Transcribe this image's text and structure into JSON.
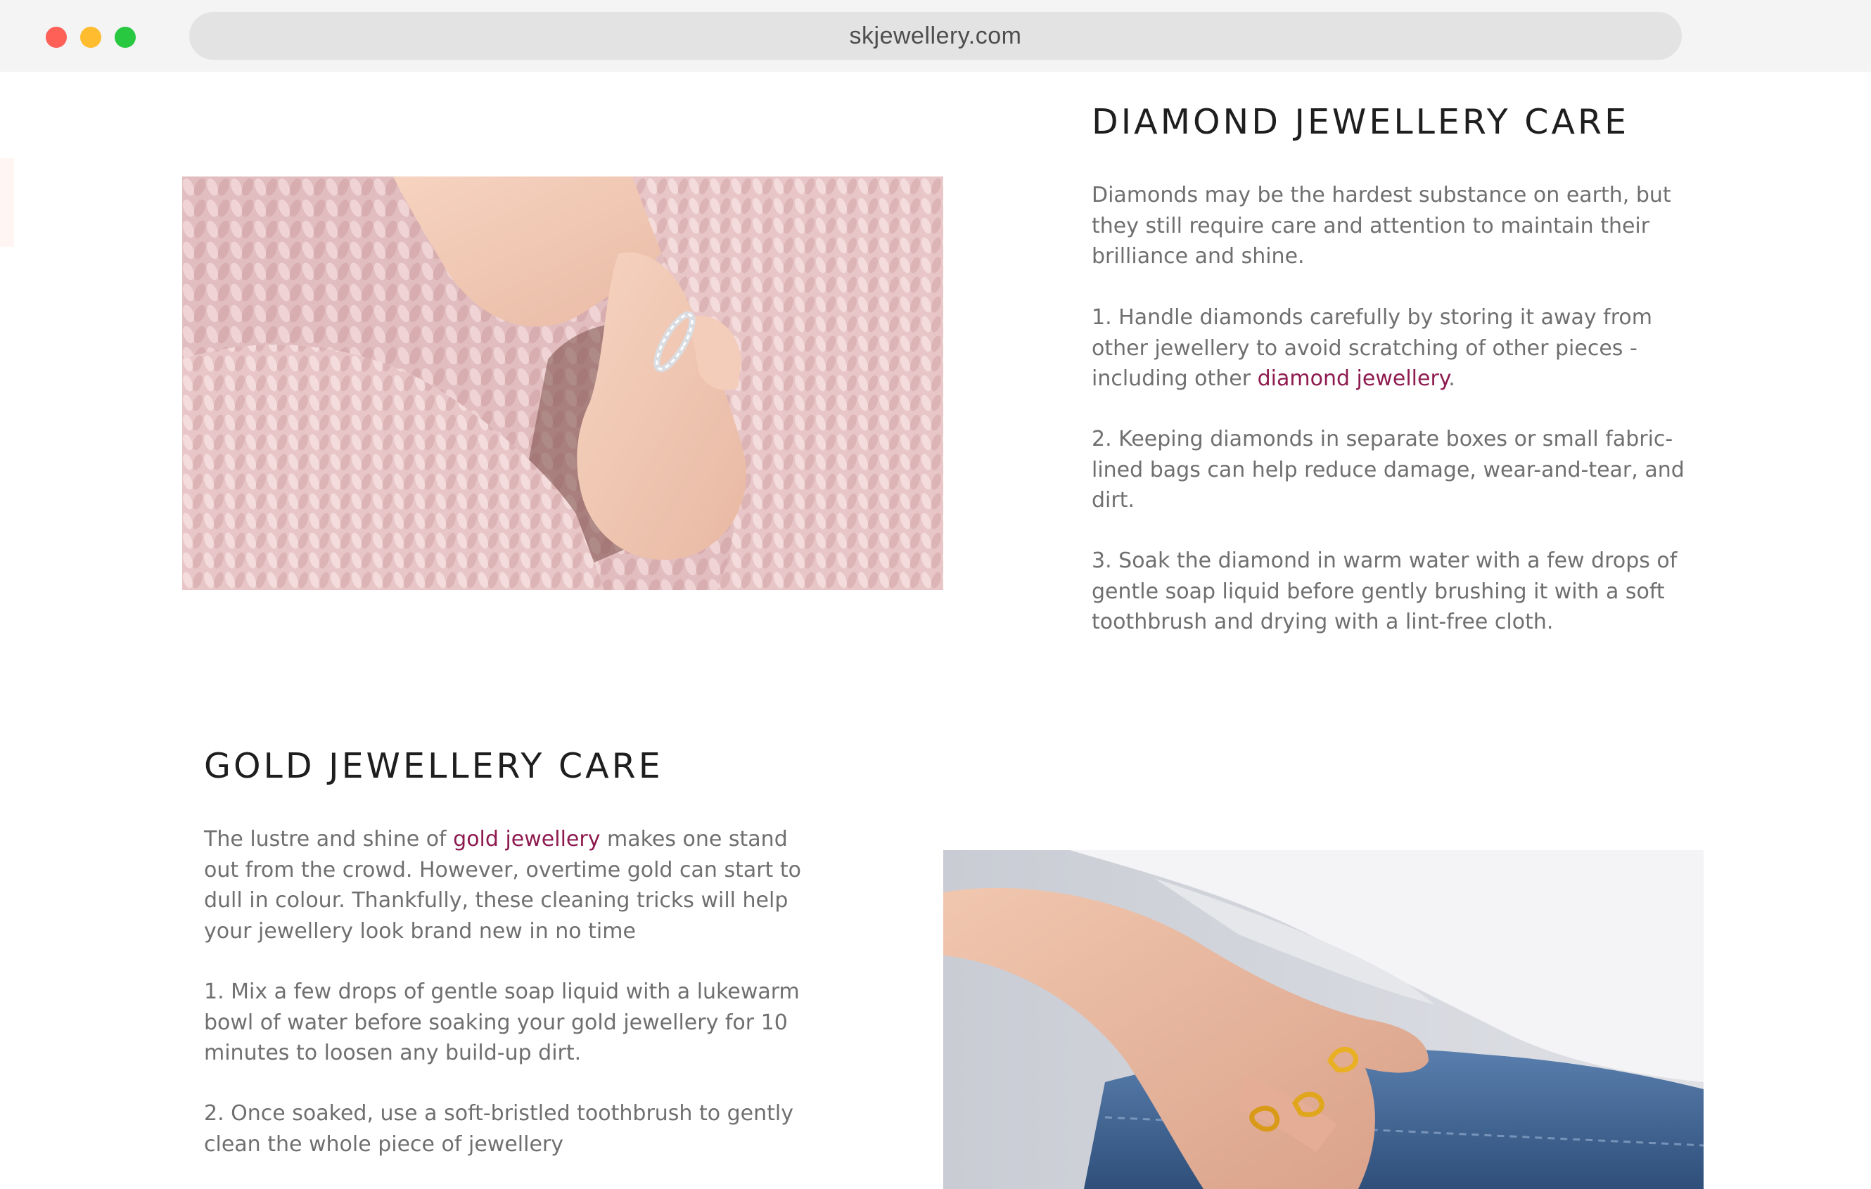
{
  "browser": {
    "url": "skjewellery.com"
  },
  "diamond_section": {
    "title": "DIAMOND JEWELLERY CARE",
    "intro": "Diamonds may be the hardest substance on earth, but they still require care and attention to maintain their brilliance and shine.",
    "step1_before": "1. Handle diamonds carefully by storing it away from other jewellery to avoid scratching of other pieces - including other ",
    "step1_link": "diamond jewellery",
    "step1_after": ".",
    "step2": "2. Keeping diamonds in separate boxes or small fabric-lined bags can help reduce damage, wear-and-tear, and dirt.",
    "step3": "3. Soak the diamond in warm water with a few drops of gentle soap liquid before gently brushing it with a soft toothbrush and drying with a lint-free cloth."
  },
  "gold_section": {
    "title": "GOLD JEWELLERY CARE",
    "intro_before": "The lustre and shine of ",
    "intro_link": "gold jewellery",
    "intro_after": " makes one stand out from the crowd. However, overtime gold can start to dull in colour. Thankfully, these cleaning tricks will help your jewellery look brand new in no time",
    "step1": "1. Mix a few drops of gentle soap liquid with a lukewarm bowl of water before soaking your gold jewellery for 10 minutes to loosen any build-up dirt.",
    "step2": "2. Once soaked, use a soft-bristled toothbrush to gently clean the whole piece of jewellery"
  },
  "colors": {
    "link": "#8e1b4f",
    "body_text": "#6f6f6f",
    "heading": "#1e1e1e"
  }
}
